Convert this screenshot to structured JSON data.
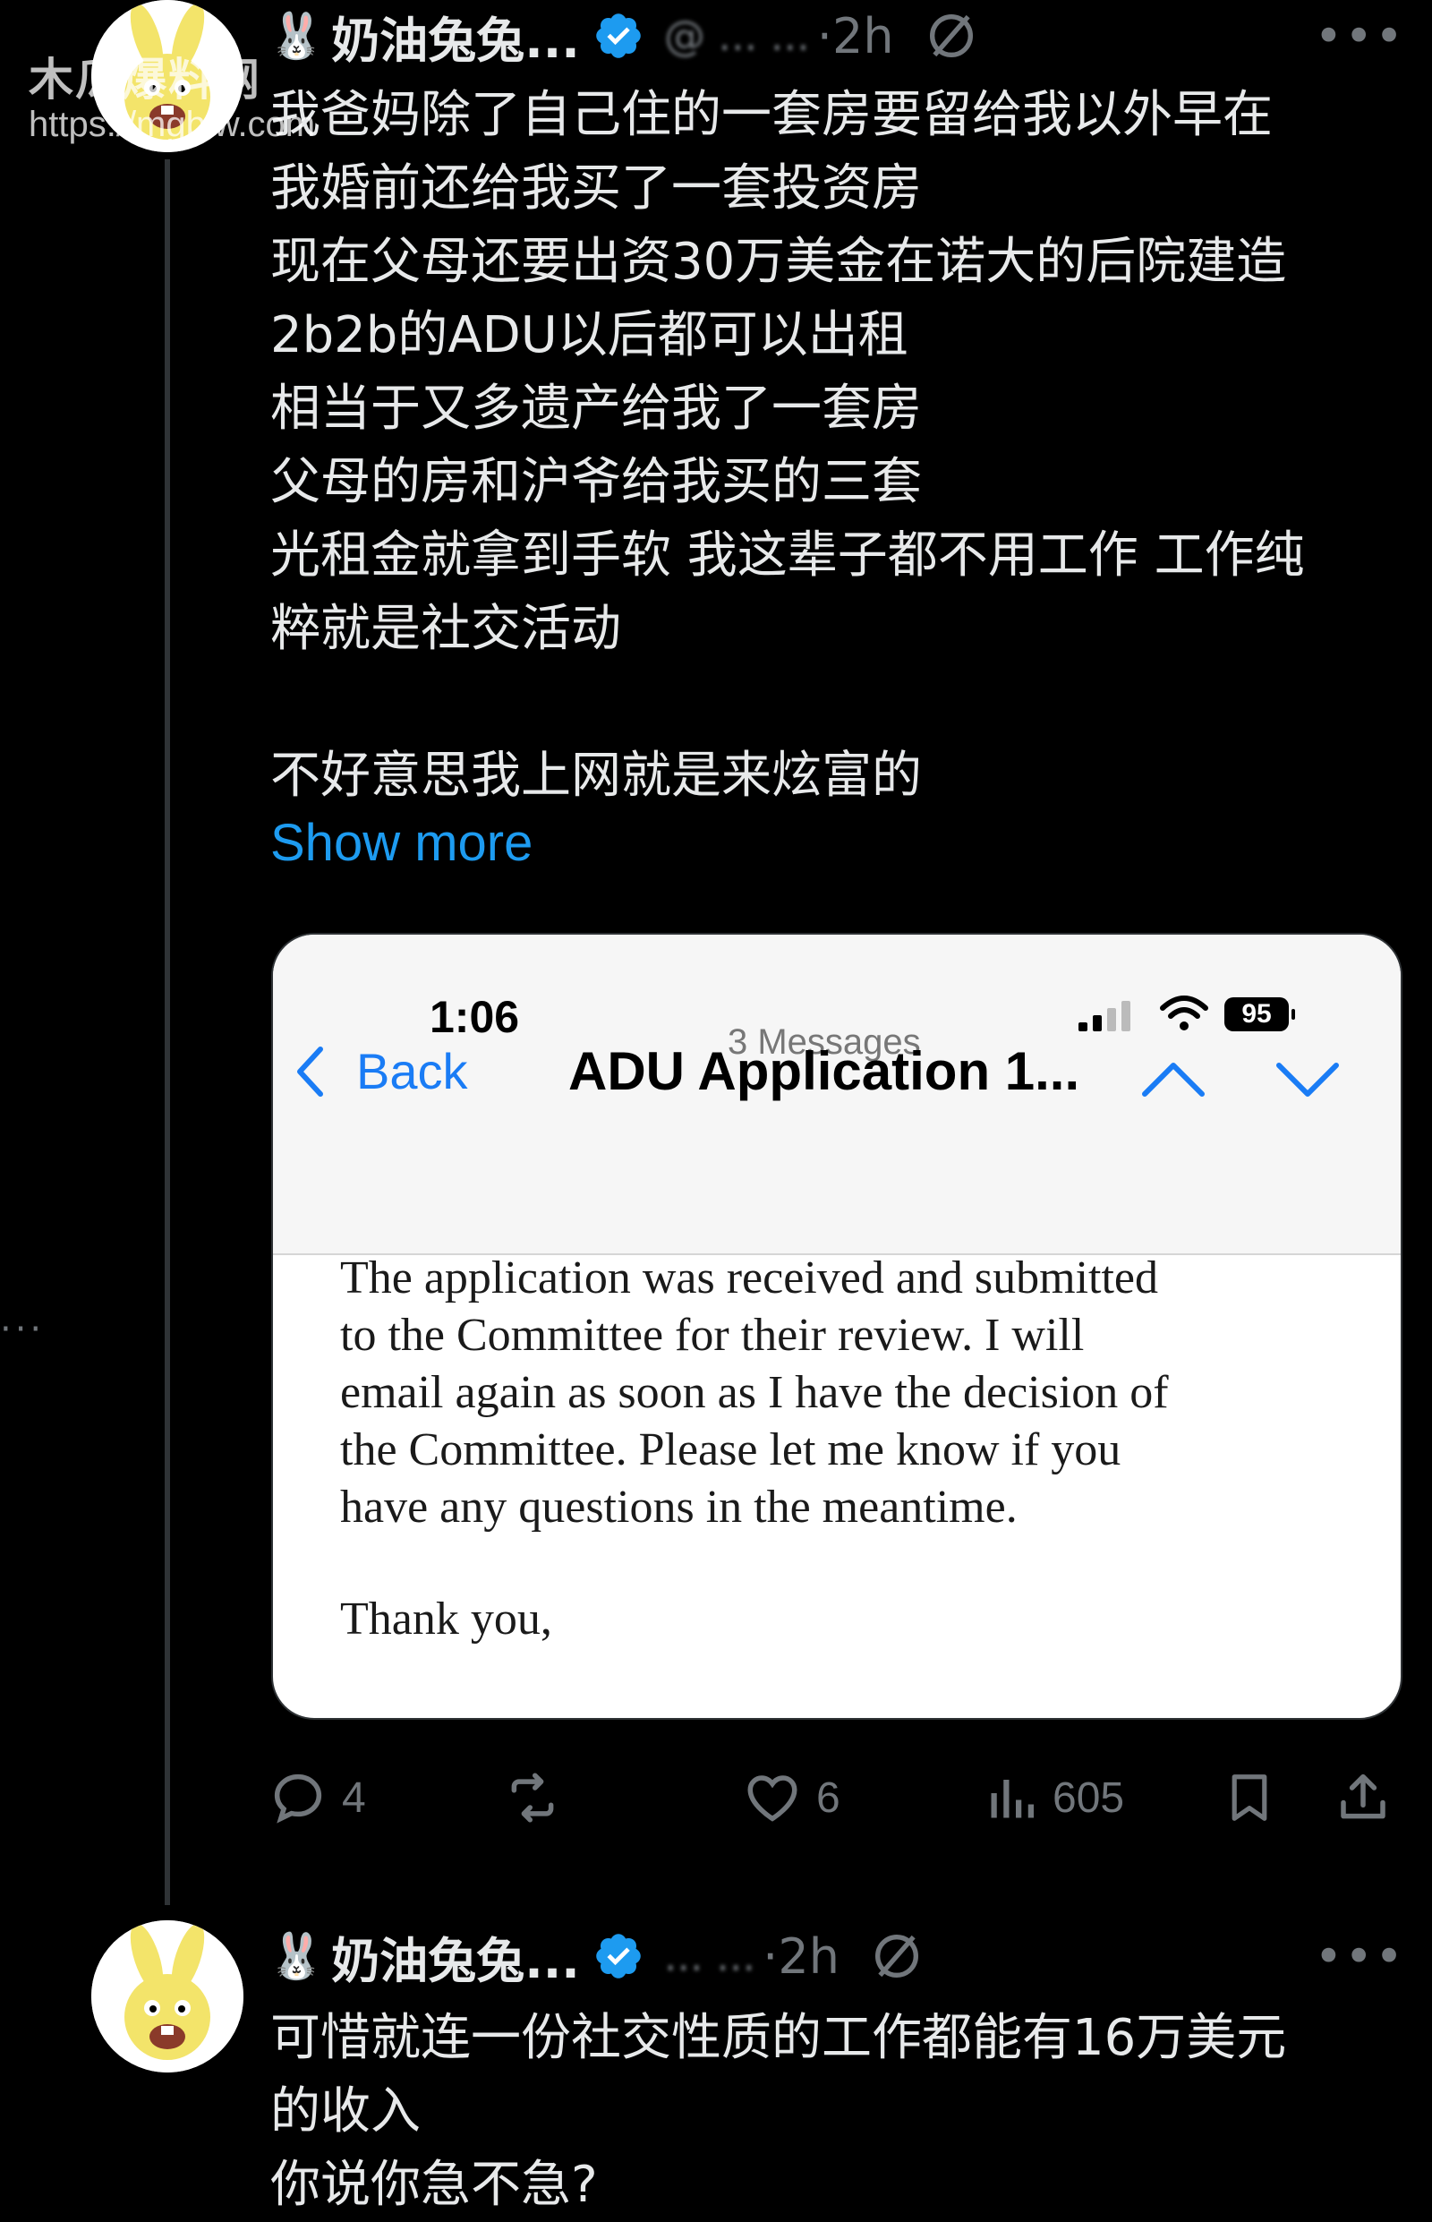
{
  "watermark": {
    "title": "木瓜爆料网",
    "url": "https://mgblw.com"
  },
  "tweets": [
    {
      "display_name": "奶油兔兔...",
      "handle": "@ ... ...",
      "time": "2h",
      "body": [
        "我爸妈除了自己住的一套房要留给我以外早在",
        "我婚前还给我买了一套投资房",
        "现在父母还要出资30万美金在诺大的后院建造",
        "2b2b的ADU以后都可以出租",
        "相当于又多遗产给我了一套房",
        "父母的房和沪爷给我买的三套",
        "光租金就拿到手软 我这辈子都不用工作 工作纯",
        "粹就是社交活动",
        "",
        "不好意思我上网就是来炫富的"
      ],
      "show_more": "Show more",
      "actions": {
        "replies": "4",
        "reposts": "",
        "likes": "6",
        "views": "605"
      }
    },
    {
      "display_name": "奶油兔兔...",
      "handle": "... ...",
      "time": "2h",
      "body": [
        "可惜就连一份社交性质的工作都能有16万美元",
        "的收入",
        "你说你急不急?"
      ]
    }
  ],
  "email_screenshot": {
    "status_time": "1:06",
    "battery": "95",
    "back_label": "Back",
    "messages_count": "3 Messages",
    "subject": "ADU Application 1...",
    "body_lines": [
      "The application was received and submitted",
      "to the Committee for their review.  I will",
      "email again as soon as I have the decision of",
      "the Committee.  Please let me know if you",
      "have any questions in the meantime."
    ],
    "signoff": "Thank you,"
  },
  "colors": {
    "background": "#000000",
    "text": "#e7e9ea",
    "muted": "#71767b",
    "link": "#1d9bf0",
    "verified": "#1d9bf0",
    "ios_blue": "#1a7cf5"
  },
  "icons": {
    "verified": "verified-badge-icon",
    "grok": "grok-icon",
    "more": "more-icon",
    "reply": "reply-icon",
    "retweet": "retweet-icon",
    "like": "heart-icon",
    "views": "views-icon",
    "bookmark": "bookmark-icon",
    "share": "share-icon"
  }
}
